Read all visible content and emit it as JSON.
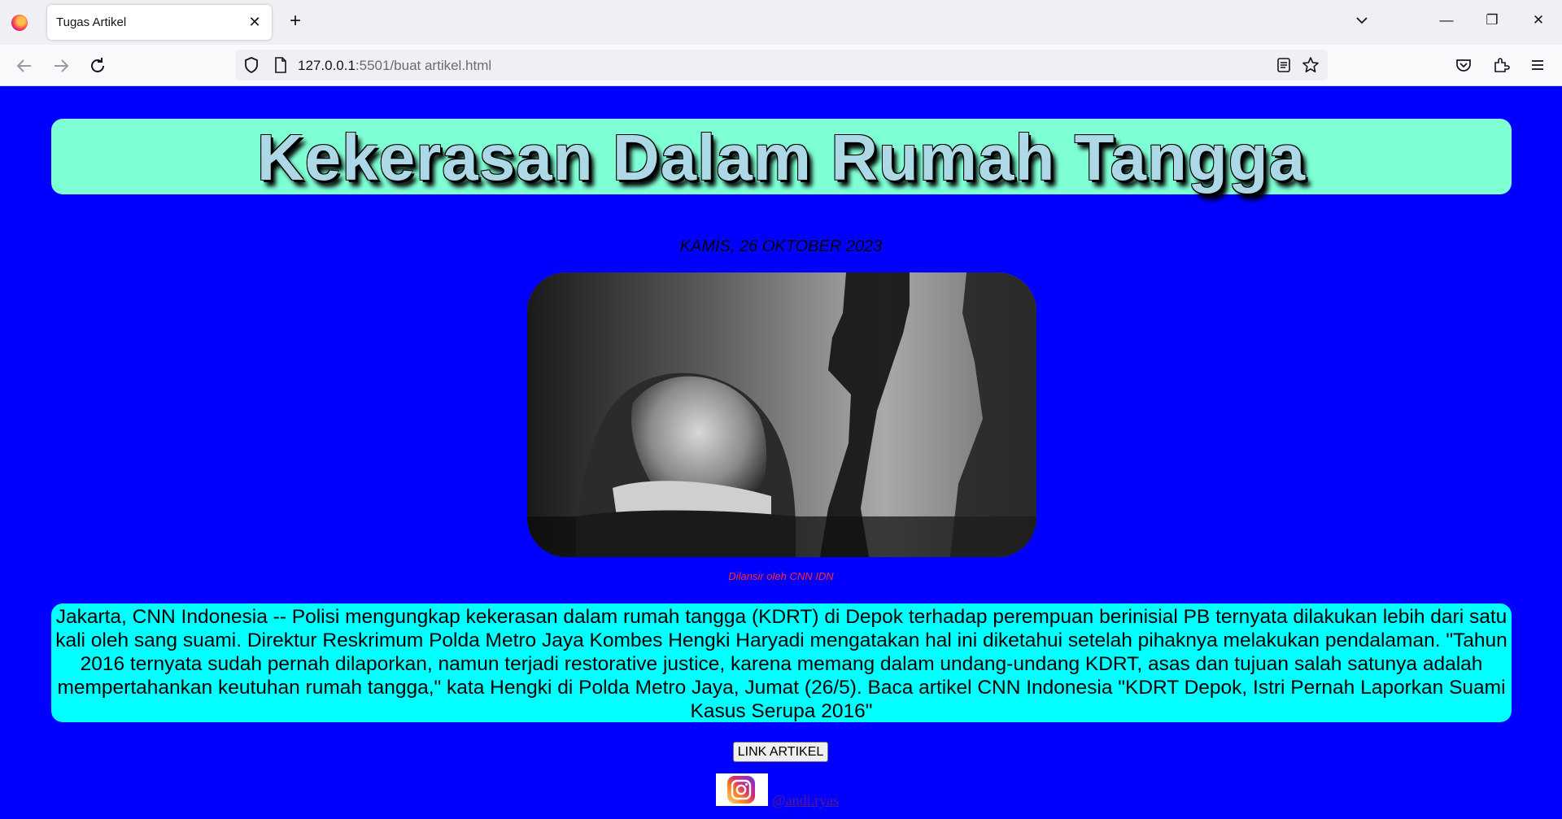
{
  "browser": {
    "tab_title": "Tugas Artikel",
    "tab_close": "✕",
    "new_tab": "+",
    "url_host": "127.0.0.1",
    "url_rest": ":5501/buat artikel.html",
    "window_controls": [
      "—",
      "❐",
      "✕"
    ]
  },
  "article": {
    "title": "Kekerasan Dalam Rumah Tangga",
    "date": "KAMIS, 26 OKTOBER 2023",
    "image_caption": "Dilansir oleh CNN IDN",
    "body": "Jakarta, CNN Indonesia -- Polisi mengungkap kekerasan dalam rumah tangga (KDRT) di Depok terhadap perempuan berinisial PB ternyata dilakukan lebih dari satu kali oleh sang suami. Direktur Reskrimum Polda Metro Jaya Kombes Hengki Haryadi mengatakan hal ini diketahui setelah pihaknya melakukan pendalaman. \"Tahun 2016 ternyata sudah pernah dilaporkan, namun terjadi restorative justice, karena memang dalam undang-undang KDRT, asas dan tujuan salah satunya adalah mempertahankan keutuhan rumah tangga,\" kata Hengki di Polda Metro Jaya, Jumat (26/5). Baca artikel CNN Indonesia \"KDRT Depok, Istri Pernah Laporkan Suami Kasus Serupa 2016\"",
    "link_button": "LINK ARTIKEL",
    "instagram_handle": "@andi.ryas"
  },
  "colors": {
    "page_bg": "#0000fe",
    "header_bg": "#7fffd4",
    "title_color": "#add8e6",
    "article_bg": "#00ffff",
    "caption_color": "#ff2a2a"
  }
}
